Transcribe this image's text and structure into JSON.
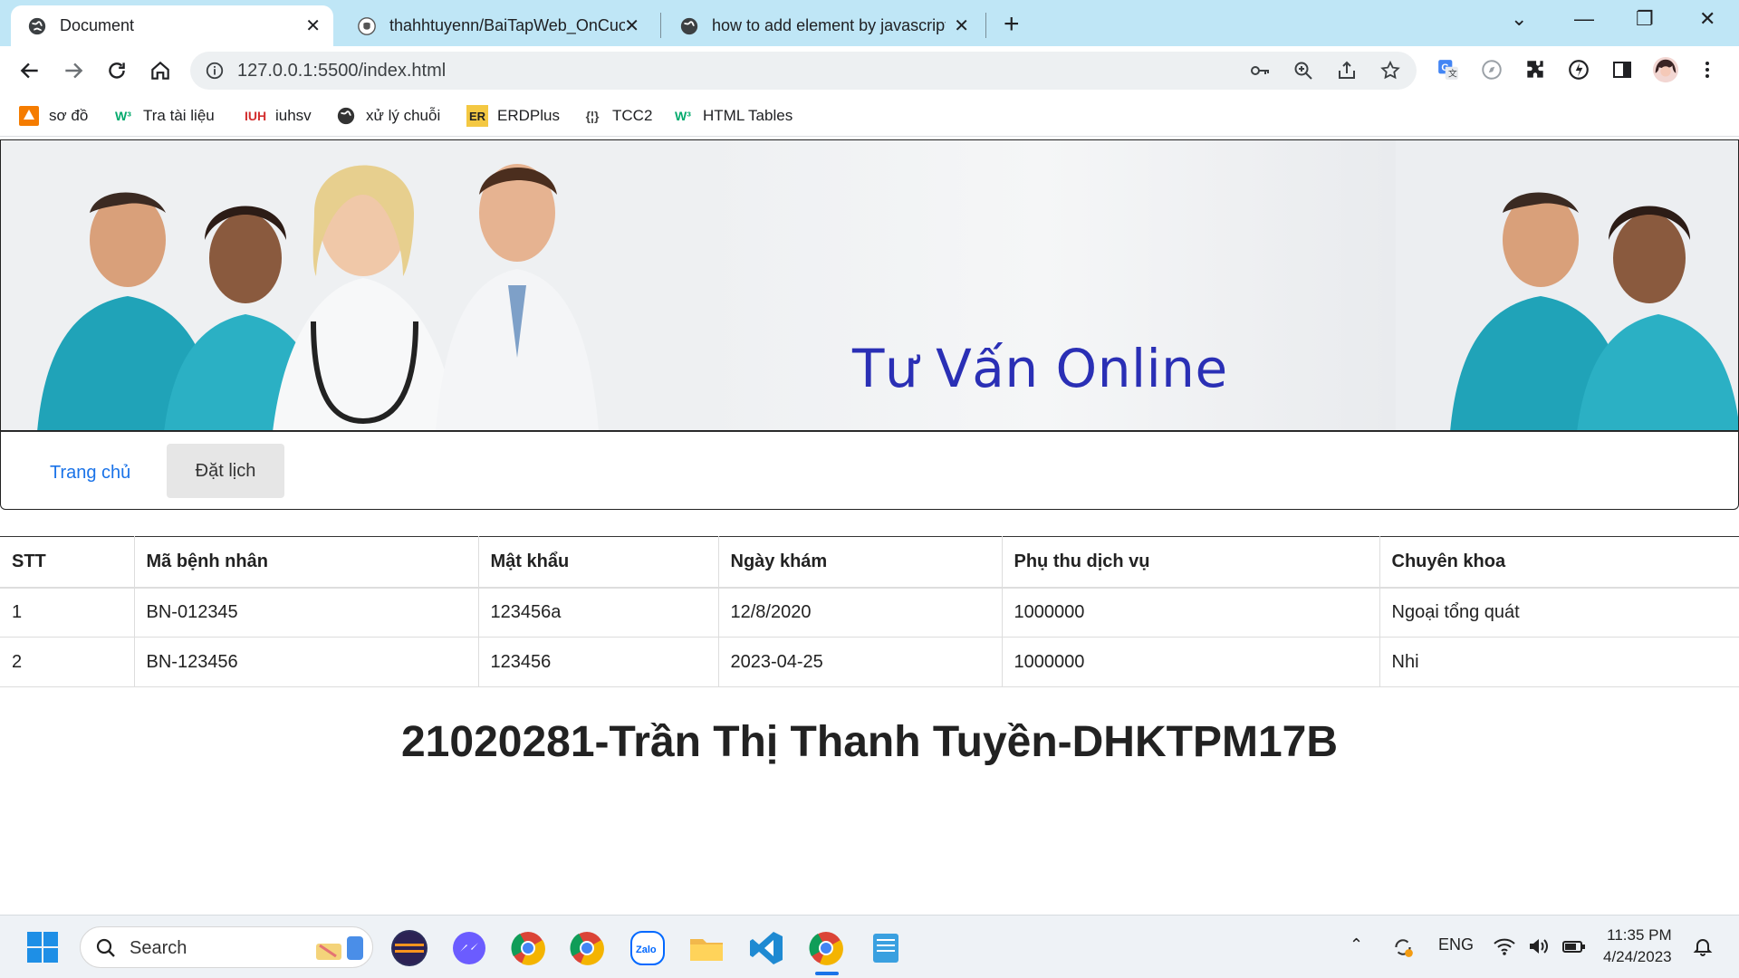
{
  "browser": {
    "tabs": [
      {
        "title": "Document",
        "active": true,
        "favicon": "globe-icon"
      },
      {
        "title": "thahhtuyenn/BaiTapWeb_OnCuoi",
        "active": false,
        "favicon": "github-icon"
      },
      {
        "title": "how to add element by javascript",
        "active": false,
        "favicon": "globe-icon"
      }
    ],
    "url": "127.0.0.1:5500/index.html",
    "bookmarks": [
      {
        "label": "sơ đồ",
        "icon": "diagram-icon",
        "color": "#f57c00"
      },
      {
        "label": "Tra tài liệu",
        "icon": "w3-icon",
        "color": "#04aa6d"
      },
      {
        "label": "iuhsv",
        "icon": "iuh-icon",
        "color": "#d32f2f"
      },
      {
        "label": "xử lý chuỗi",
        "icon": "globe-icon",
        "color": "#333333"
      },
      {
        "label": "ERDPlus",
        "icon": "er-icon",
        "color": "#f4c842"
      },
      {
        "label": "TCC2",
        "icon": "braces-icon",
        "color": "#444444"
      },
      {
        "label": "HTML Tables",
        "icon": "w3-icon",
        "color": "#04aa6d"
      }
    ]
  },
  "page": {
    "banner_title": "Tư Vấn Online",
    "nav": {
      "home": "Trang chủ",
      "book": "Đặt lịch"
    },
    "table": {
      "headers": [
        "STT",
        "Mã bệnh nhân",
        "Mật khẩu",
        "Ngày khám",
        "Phụ thu dịch vụ",
        "Chuyên khoa"
      ],
      "rows": [
        [
          "1",
          "BN-012345",
          "123456a",
          "12/8/2020",
          "1000000",
          "Ngoại tổng quát"
        ],
        [
          "2",
          "BN-123456",
          "123456",
          "2023-04-25",
          "1000000",
          "Nhi"
        ]
      ]
    },
    "student": "21020281-Trần Thị Thanh Tuyền-DHKTPM17B"
  },
  "taskbar": {
    "search_label": "Search",
    "tray": {
      "language": "ENG"
    },
    "time": "11:35 PM",
    "date": "4/24/2023"
  },
  "colors": {
    "tab_strip": "#bfe6f6",
    "banner_text": "#2a2fb5",
    "link": "#1a73e8"
  }
}
